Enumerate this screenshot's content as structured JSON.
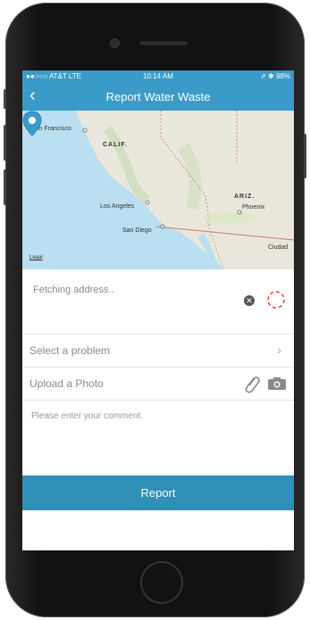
{
  "statusbar": {
    "carrier": "●●○○○ AT&T  LTE",
    "time": "10:14 AM",
    "right": "⇗ ✱ 98%"
  },
  "navbar": {
    "back_icon": "chevron-left-icon",
    "title": "Report Water Waste"
  },
  "map": {
    "labels": {
      "san_francisco": "San Francisco",
      "calif": "CALIF.",
      "los_angeles": "Los Angeles",
      "san_diego": "San Diego",
      "ariz": "ARIZ.",
      "phoenix": "Phoenix",
      "ciudad": "Ciudad",
      "legal": "Legal"
    },
    "pin_icon": "map-pin-icon",
    "colors": {
      "water": "#b9dff0",
      "land": "#e9e7db",
      "pin": "#3a9bc9"
    }
  },
  "address": {
    "text": "Fetching address..",
    "clear_icon": "clear-icon",
    "locate_icon": "locate-icon"
  },
  "problem": {
    "label": "Select a problem",
    "chevron": "›"
  },
  "photo": {
    "label": "Upload a Photo",
    "attach_icon": "paperclip-icon",
    "camera_icon": "camera-icon"
  },
  "comment": {
    "placeholder": "Please enter your comment."
  },
  "report": {
    "label": "Report",
    "color": "#2f8fb7"
  }
}
